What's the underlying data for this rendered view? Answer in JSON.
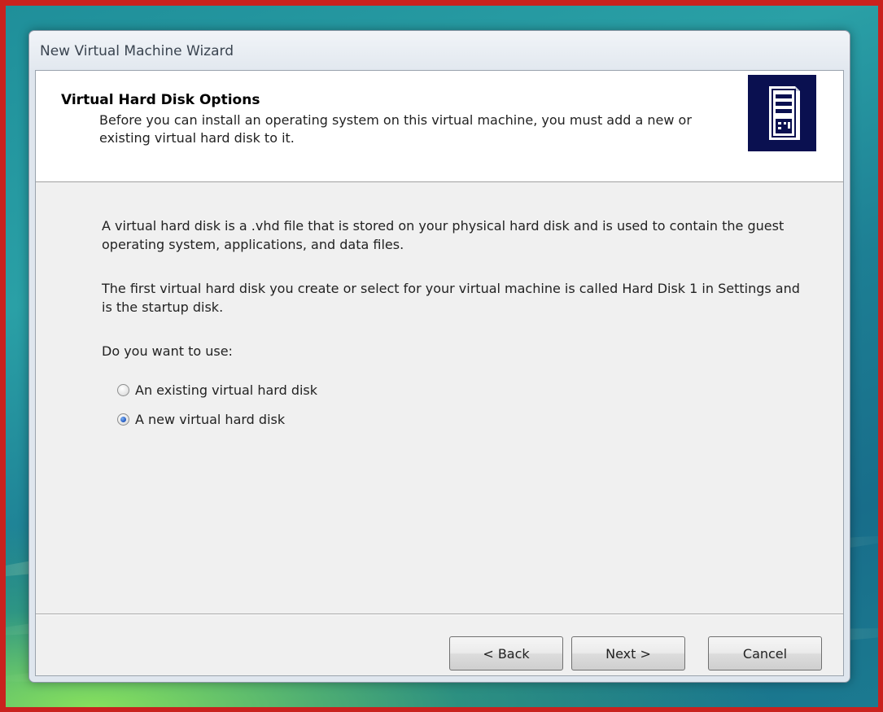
{
  "window": {
    "title": "New Virtual Machine Wizard"
  },
  "header": {
    "title": "Virtual Hard Disk Options",
    "description": "Before you can install an operating system on this virtual machine, you must add a new or existing virtual hard disk to it.",
    "icon": "server-tower-icon"
  },
  "content": {
    "paragraph1": "A virtual hard disk is a .vhd file that is stored on your physical hard disk and is used to contain the guest operating system, applications, and data files.",
    "paragraph2": "The first virtual hard disk you create or select for your virtual machine is called Hard Disk 1 in Settings and is the startup disk.",
    "question": "Do you want to use:",
    "options": [
      {
        "label": "An existing virtual hard disk",
        "selected": false
      },
      {
        "label": "A new virtual hard disk",
        "selected": true
      }
    ]
  },
  "buttons": {
    "back": "< Back",
    "next": "Next >",
    "cancel": "Cancel"
  },
  "colors": {
    "frame": "#c9221e",
    "header_icon_bg": "#0a1050",
    "radio_selected": "#2c62c8"
  }
}
